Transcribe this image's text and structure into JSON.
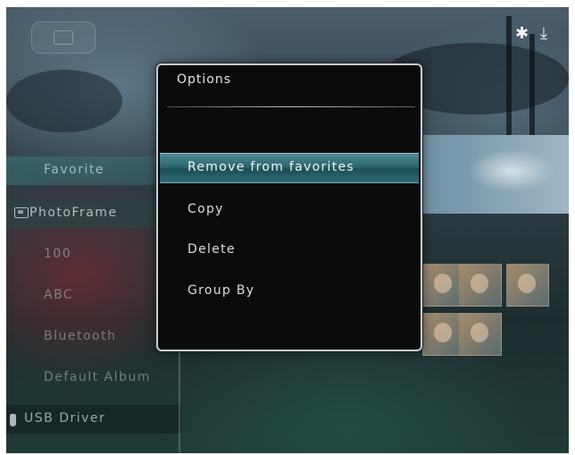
{
  "status_bar": {
    "bluetooth_icon": "bluetooth-icon",
    "download_icon": "download-icon"
  },
  "sidebar": {
    "items": [
      {
        "label": "Favorite",
        "state": "selected"
      },
      {
        "label": "PhotoFrame",
        "state": "group",
        "icon": "photoframe-icon"
      },
      {
        "label": "100"
      },
      {
        "label": "ABC"
      },
      {
        "label": "Bluetooth"
      },
      {
        "label": "Default Album"
      },
      {
        "label": "USB Driver",
        "state": "group",
        "icon": "usb-icon"
      }
    ]
  },
  "dialog": {
    "title": "Options",
    "items": [
      {
        "label": "Remove from favorites",
        "selected": true
      },
      {
        "label": "Copy"
      },
      {
        "label": "Delete"
      },
      {
        "label": "Group By"
      }
    ]
  },
  "colors": {
    "highlight": "#2d6670",
    "dialog_bg": "#0b0b0b",
    "dialog_border": "#c6cdd0"
  }
}
